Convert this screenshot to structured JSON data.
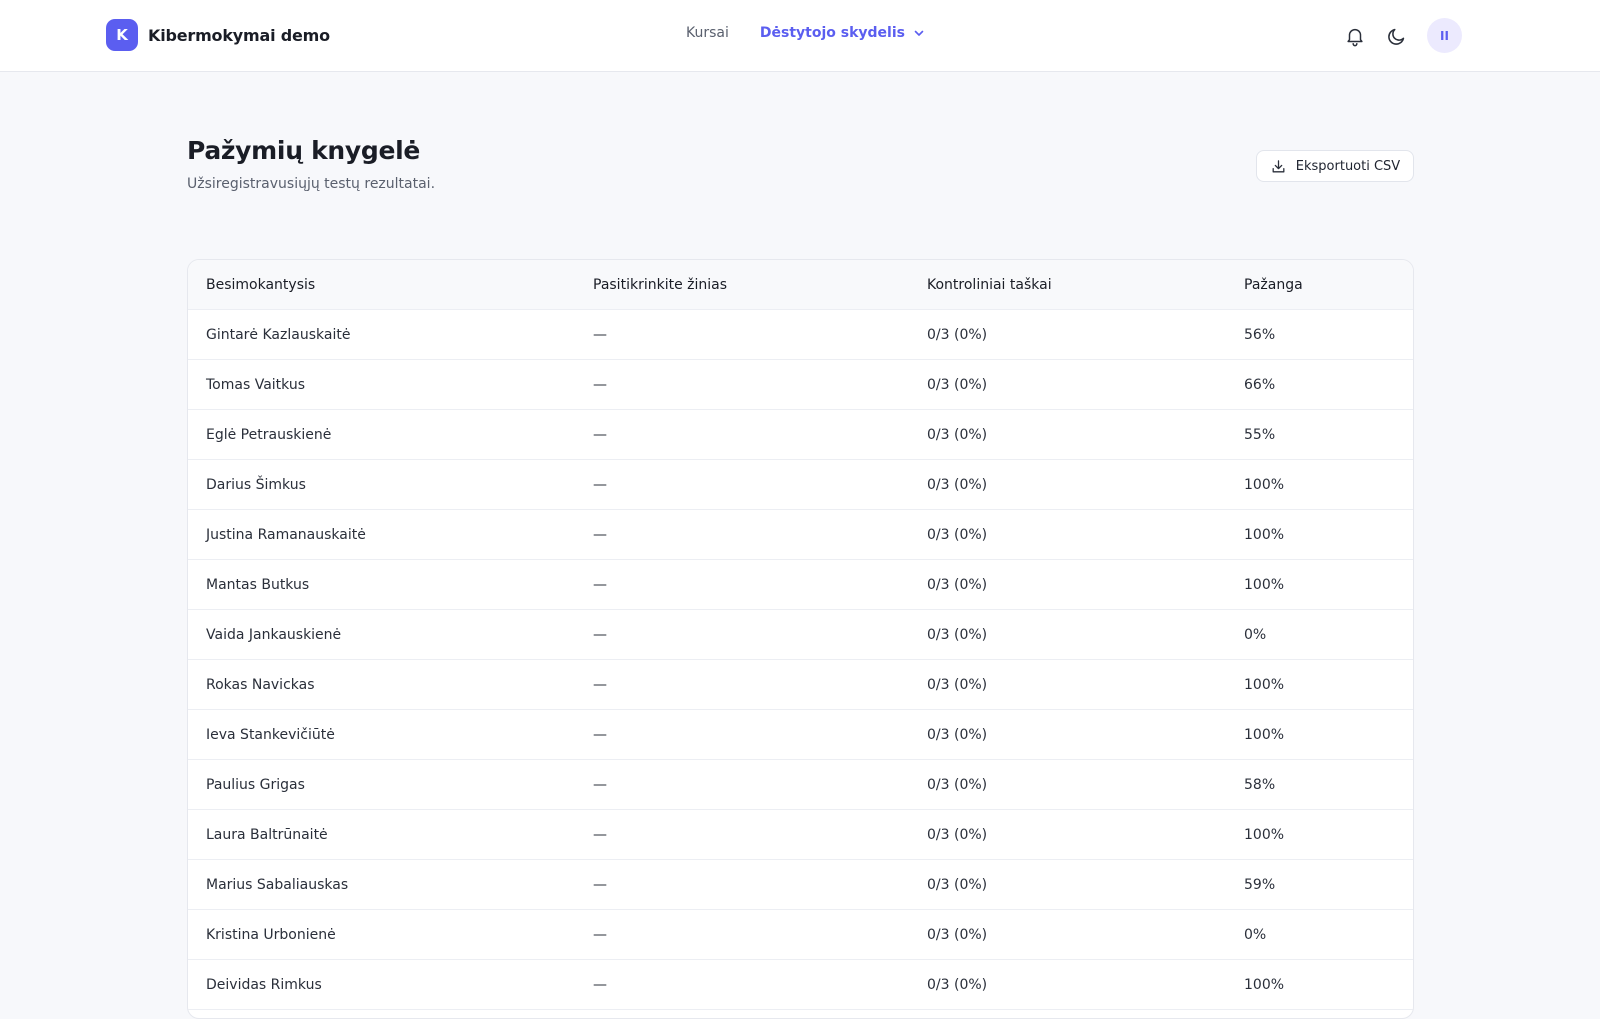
{
  "brand": {
    "logo_letter": "K",
    "name": "Kibermokymai demo"
  },
  "nav": {
    "courses": "Kursai",
    "teacher_dashboard": "Dėstytojo skydelis"
  },
  "user": {
    "initials": "II"
  },
  "colors": {
    "accent": "#5b5ef0",
    "background": "#f7f8fb"
  },
  "page": {
    "title": "Pažymių knygelė",
    "subtitle": "Užsiregistravusiųjų testų rezultatai.",
    "export_label": "Eksportuoti CSV"
  },
  "table": {
    "headers": [
      "Besimokantysis",
      "Pasitikrinkite žinias",
      "Kontroliniai taškai",
      "Pažanga"
    ],
    "rows": [
      [
        "Gintarė Kazlauskaitė",
        "—",
        "0/3 (0%)",
        "56%"
      ],
      [
        "Tomas Vaitkus",
        "—",
        "0/3 (0%)",
        "66%"
      ],
      [
        "Eglė Petrauskienė",
        "—",
        "0/3 (0%)",
        "55%"
      ],
      [
        "Darius Šimkus",
        "—",
        "0/3 (0%)",
        "100%"
      ],
      [
        "Justina Ramanauskaitė",
        "—",
        "0/3 (0%)",
        "100%"
      ],
      [
        "Mantas Butkus",
        "—",
        "0/3 (0%)",
        "100%"
      ],
      [
        "Vaida Jankauskienė",
        "—",
        "0/3 (0%)",
        "0%"
      ],
      [
        "Rokas Navickas",
        "—",
        "0/3 (0%)",
        "100%"
      ],
      [
        "Ieva Stankevičiūtė",
        "—",
        "0/3 (0%)",
        "100%"
      ],
      [
        "Paulius Grigas",
        "—",
        "0/3 (0%)",
        "58%"
      ],
      [
        "Laura Baltrūnaitė",
        "—",
        "0/3 (0%)",
        "100%"
      ],
      [
        "Marius Sabaliauskas",
        "—",
        "0/3 (0%)",
        "59%"
      ],
      [
        "Kristina Urbonienė",
        "—",
        "0/3 (0%)",
        "0%"
      ],
      [
        "Deividas Rimkus",
        "—",
        "0/3 (0%)",
        "100%"
      ]
    ]
  }
}
